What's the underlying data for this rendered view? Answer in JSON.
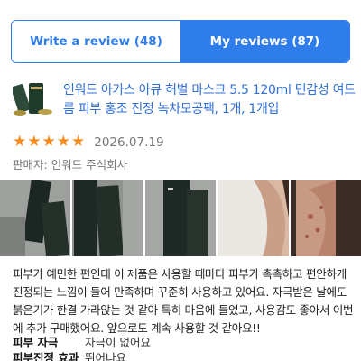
{
  "tabs": {
    "write_review": "Write a review (48)",
    "my_reviews": "My reviews (87)"
  },
  "product": {
    "name": "인워드 아가스 아큐 허벌 마스크 5.5 120ml 민감성 여드름 피부 홍조 진정 녹차모공팩, 1개, 1개입"
  },
  "review": {
    "rating": 5,
    "rating_max": 5,
    "date": "2026.07.19",
    "seller": "판매자: 인워드 주식회사",
    "text": "피부가 예민한 편인데 이 제품은 사용할 때마다 피부가 촉촉하고 편안하게 진정되는 느낌이 들어 만족하며 꾸준히 사용하고 있어요. 자극받은 날에도 붉은기가 한결 가라앉는 것 같아 특히 마음에 들었고, 사용감도 좋아서 이번에 추가 구매했어요. 앞으로도 계속 사용할 것 같아요!!",
    "attributes": [
      {
        "label": "피부 자극",
        "value": "자극이 없어요"
      },
      {
        "label": "피부진정 효과",
        "value": "뛰어나요"
      }
    ]
  },
  "colors": {
    "accent": "#2f7dea",
    "star": "#f48b1f",
    "product_link": "#2f6fd8"
  },
  "icons": {
    "star": "star-icon"
  }
}
